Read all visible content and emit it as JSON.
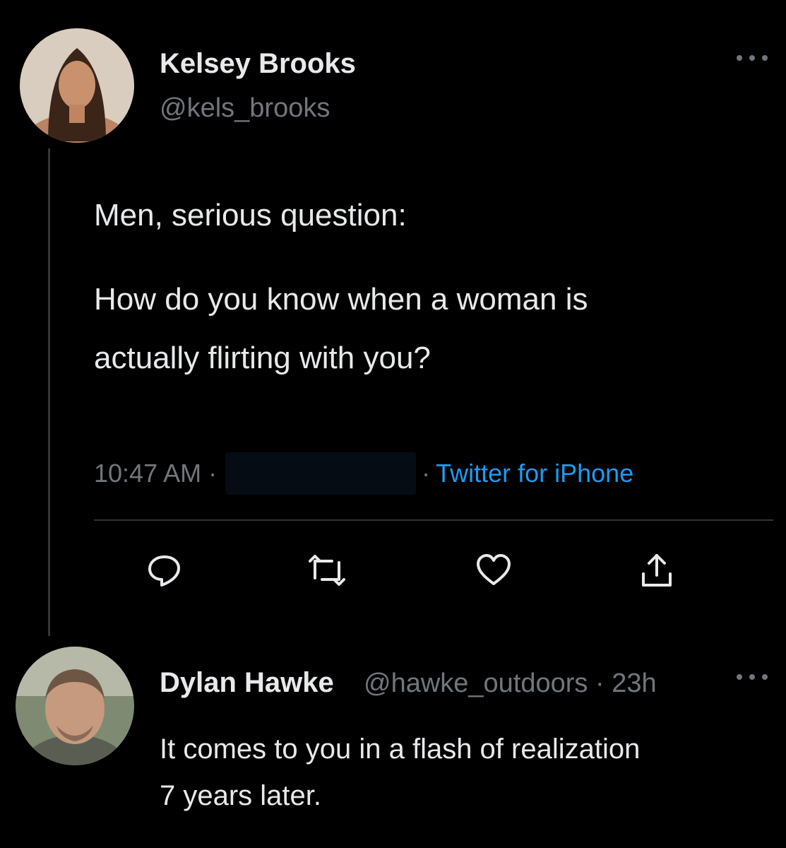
{
  "tweet": {
    "author_name": "Kelsey Brooks",
    "author_handle": "@kels_brooks",
    "text_line1": "Men, serious question:",
    "text_line2": "How do you know when a woman is",
    "text_line3": "actually flirting with you?",
    "time": "10:47 AM ·",
    "source_prefix": "·",
    "source": "Twitter for iPhone"
  },
  "actions": [
    "reply-icon",
    "retweet-icon",
    "like-icon",
    "share-icon"
  ],
  "reply": {
    "author_name": "Dylan Hawke",
    "author_handle": "@hawke_outdoors · 23h",
    "text_line1": "It comes to you in a flash of realization",
    "text_line2": "7 years later."
  },
  "colors": {
    "background": "#000000",
    "text": "#e7e9ea",
    "secondary": "#71767b",
    "link": "#1d9bf0"
  }
}
